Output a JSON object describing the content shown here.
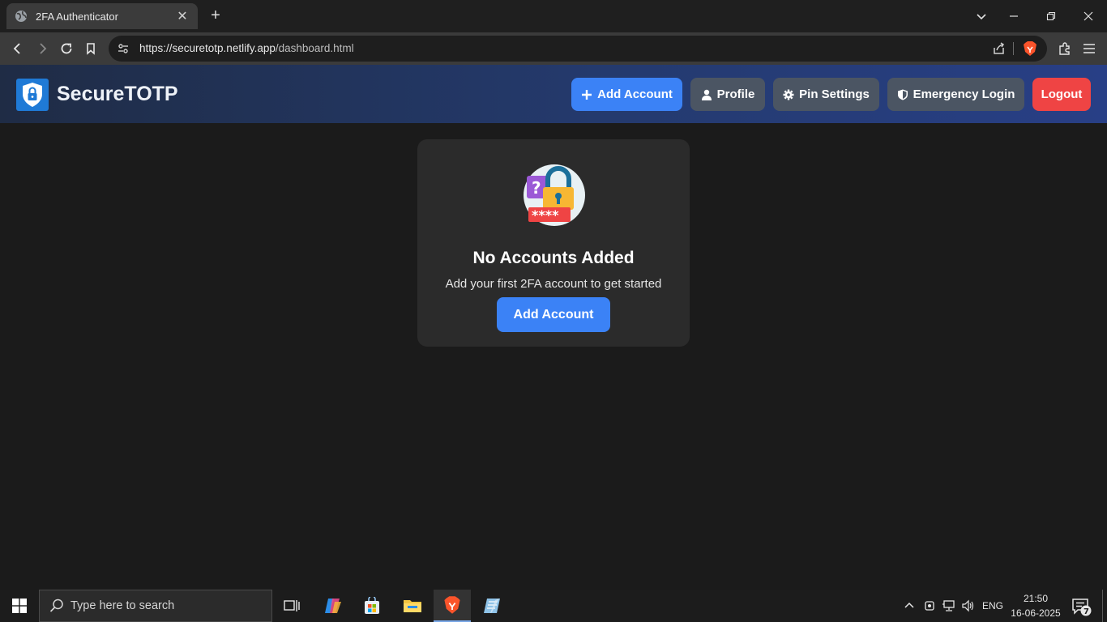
{
  "browser": {
    "tab_title": "2FA Authenticator",
    "url_host": "https://securetotp.netlify.app",
    "url_path": "/dashboard.html"
  },
  "app": {
    "brand": "SecureTOTP",
    "header_buttons": {
      "add_account": "Add Account",
      "profile": "Profile",
      "pin_settings": "Pin Settings",
      "emergency_login": "Emergency Login",
      "logout": "Logout"
    },
    "empty_state": {
      "title": "No Accounts Added",
      "subtitle": "Add your first 2FA account to get started",
      "button": "Add Account",
      "password_mask": "****"
    }
  },
  "taskbar": {
    "search_placeholder": "Type here to search",
    "language": "ENG",
    "time": "21:50",
    "date": "16-06-2025",
    "notification_count": "7"
  },
  "colors": {
    "primary": "#3b82f6",
    "secondary": "#4b5563",
    "danger": "#ef4444",
    "background": "#1b1b1b",
    "card": "#2b2b2b"
  }
}
